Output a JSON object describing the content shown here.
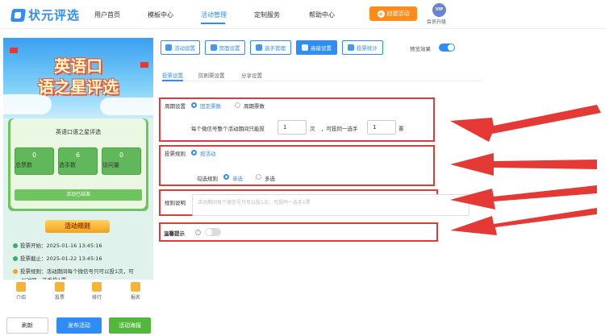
{
  "brand": {
    "name": "状元评选"
  },
  "nav": {
    "items": [
      "用户首页",
      "模板中心",
      "活动管理",
      "定制服务",
      "帮助中心"
    ],
    "active": "活动管理",
    "create_button": "创建活动",
    "vip_badge": "VIP",
    "vip_label": "会员升级"
  },
  "preview": {
    "banner_title_line1": "英语口",
    "banner_title_line2": "语之星评选",
    "activity_title": "英语口语之星评选",
    "stats": [
      {
        "value": "0",
        "label": "总票数"
      },
      {
        "value": "6",
        "label": "选手数"
      },
      {
        "value": "0",
        "label": "访问量"
      }
    ],
    "status_text": "活动已结束",
    "rules_heading": "活动规则",
    "rules": [
      "投票开始：2025-01-16 13:45:16",
      "投票截止：2025-01-22 13:45:16",
      "投票规则：活动期间每个微信号只可以投1次，可",
      "以对同一选手投1票"
    ],
    "tabbar": [
      "介绍",
      "投票",
      "排行",
      "报名"
    ]
  },
  "bottom_actions": {
    "refresh": "刷新",
    "publish": "发布活动",
    "poster": "活动海报"
  },
  "toolbar": {
    "buttons": [
      "活动设置",
      "页面设置",
      "选手管理",
      "高级设置",
      "投票统计"
    ],
    "active": "高级设置",
    "preview_label": "预览效果",
    "preview_on": true
  },
  "subtabs": {
    "items": [
      "投票设置",
      "防刷票设置",
      "分享设置"
    ],
    "active": "投票设置"
  },
  "vote_settings": {
    "cycle_label": "周期设置",
    "cycle_options": [
      "固定票数",
      "周期票数"
    ],
    "cycle_selected": "固定票数",
    "quota_prefix": "每个微信号整个活动期间只能投",
    "quota_value": "1",
    "quota_unit": "次",
    "per_player_prefix": "，可投同一选手",
    "per_player_value": "1",
    "per_player_unit": "票",
    "rule_label": "投票规则",
    "rule_option": "按活动",
    "select_label": "勾选规则",
    "select_options": [
      "单选",
      "多选"
    ],
    "select_selected": "单选",
    "desc_label": "规则说明",
    "desc_placeholder": "活动期间每个微信号只可以投1次，可投同一选手1票",
    "tip_label": "温馨提示",
    "tip_help": "?",
    "tip_on": false
  },
  "colors": {
    "accent": "#2f8df5",
    "orange": "#ff8c1a",
    "green": "#52b83b",
    "red": "#e53935"
  }
}
